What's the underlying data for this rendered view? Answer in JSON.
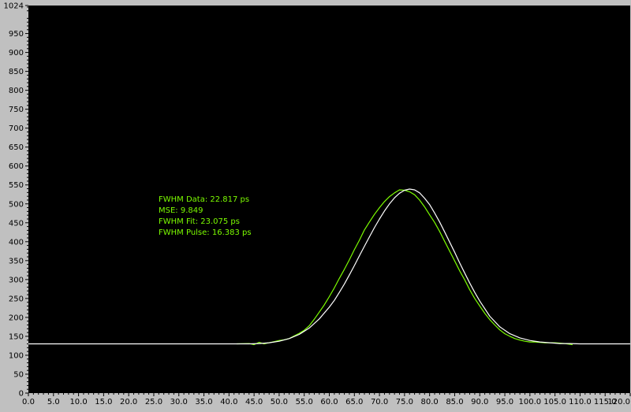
{
  "chart_data": {
    "type": "line",
    "title": "",
    "xlabel": "",
    "ylabel": "",
    "xlim": [
      0,
      120
    ],
    "ylim": [
      0,
      1024
    ],
    "grid": false,
    "background": "#000000",
    "frame_color": "#c0c0c0",
    "x_ticks": [
      "0.0",
      "5.0",
      "10.0",
      "15.0",
      "20.0",
      "25.0",
      "30.0",
      "35.0",
      "40.0",
      "45.0",
      "50.0",
      "55.0",
      "60.0",
      "65.0",
      "70.0",
      "75.0",
      "80.0",
      "85.0",
      "90.0",
      "95.0",
      "100.0",
      "105.0",
      "110.0",
      "115.0",
      "120.0"
    ],
    "y_ticks": [
      "0",
      "50",
      "100",
      "150",
      "200",
      "250",
      "300",
      "350",
      "400",
      "450",
      "500",
      "550",
      "600",
      "650",
      "700",
      "750",
      "800",
      "850",
      "900",
      "950",
      "1024"
    ],
    "annotations": [
      "FWHM Data: 22.817 ps",
      "MSE: 9.849",
      "FWHM Fit: 23.075 ps",
      "FWHM Pulse: 16.383 ps"
    ],
    "annotation_color": "#7CFC00",
    "series": [
      {
        "color": "#7CFC00",
        "x": [
          41.5,
          44,
          45,
          46,
          47,
          48,
          49,
          50,
          51,
          52,
          53,
          54,
          55,
          56,
          57,
          58,
          59,
          60,
          61,
          62,
          63,
          64,
          65,
          66,
          67,
          68,
          69,
          70,
          71,
          72,
          73,
          74,
          75,
          76,
          77,
          78,
          79,
          80,
          81,
          82,
          83,
          84,
          85,
          86,
          87,
          88,
          89,
          90,
          91,
          92,
          93,
          94,
          95,
          96,
          97,
          98,
          99,
          100,
          101,
          102,
          103,
          104,
          105,
          106,
          107,
          108.5
        ],
        "y": [
          130,
          131,
          128,
          134,
          130,
          133,
          136,
          139,
          141,
          144,
          151,
          158,
          166,
          178,
          195,
          214,
          233,
          255,
          278,
          303,
          327,
          352,
          379,
          404,
          431,
          452,
          472,
          490,
          506,
          519,
          529,
          537,
          536,
          532,
          524,
          510,
          492,
          471,
          451,
          427,
          401,
          375,
          349,
          323,
          299,
          273,
          250,
          230,
          211,
          194,
          180,
          167,
          157,
          150,
          144,
          140,
          137,
          135,
          135,
          134,
          133,
          133,
          133,
          132,
          131,
          128
        ]
      },
      {
        "color": "#ffffff",
        "x": [
          0,
          42,
          44,
          46,
          48,
          50,
          52,
          54,
          56,
          58,
          60,
          61,
          62,
          63,
          64,
          65,
          66,
          67,
          68,
          69,
          70,
          71,
          72,
          73,
          74,
          75,
          76,
          77,
          78,
          79,
          80,
          81,
          82,
          83,
          84,
          85,
          86,
          87,
          88,
          89,
          90,
          92,
          94,
          96,
          98,
          100,
          102,
          104,
          106,
          108,
          110,
          120
        ],
        "y": [
          130,
          130,
          130,
          131,
          133,
          137,
          144,
          155,
          172,
          196,
          227,
          245,
          266,
          288,
          312,
          337,
          363,
          388,
          413,
          437,
          460,
          481,
          500,
          516,
          528,
          536,
          539,
          537,
          529,
          515,
          498,
          476,
          452,
          426,
          399,
          372,
          344,
          317,
          291,
          266,
          243,
          203,
          175,
          157,
          146,
          139,
          135,
          133,
          131,
          131,
          130,
          130
        ]
      }
    ]
  }
}
